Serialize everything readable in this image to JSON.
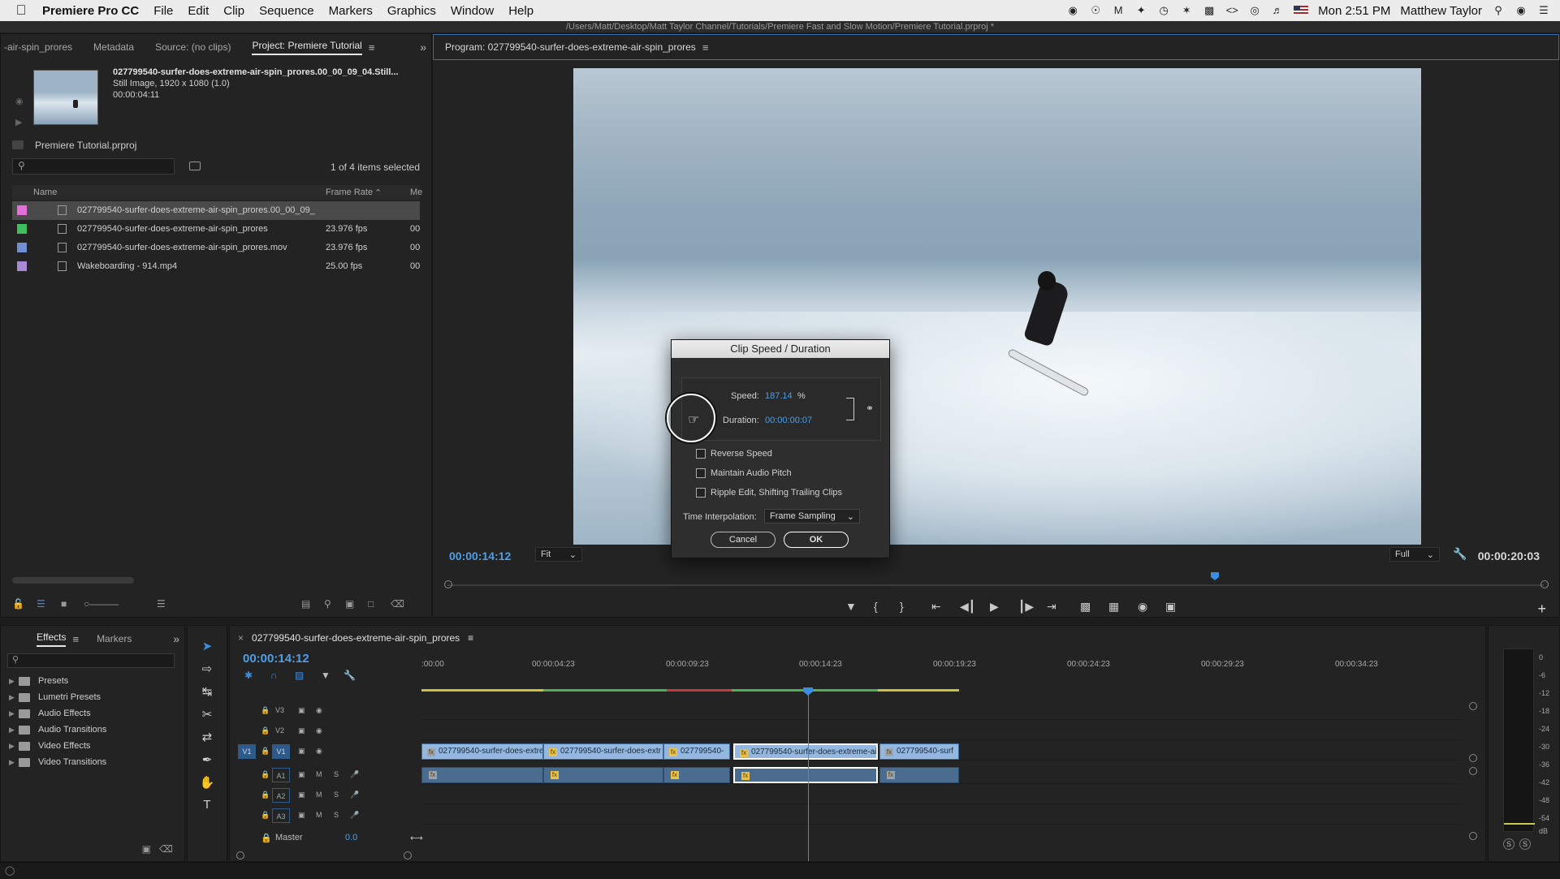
{
  "menubar": {
    "app_name": "Premiere Pro CC",
    "items": [
      "File",
      "Edit",
      "Clip",
      "Sequence",
      "Markers",
      "Graphics",
      "Window",
      "Help"
    ],
    "clock": "Mon 2:51 PM",
    "user": "Matthew Taylor"
  },
  "window": {
    "path": "/Users/Matt/Desktop/Matt Taylor Channel/Tutorials/Premiere Fast and Slow Motion/Premiere Tutorial.prproj *"
  },
  "project_panel": {
    "tabs": [
      "-air-spin_prores",
      "Metadata",
      "Source: (no clips)",
      "Project: Premiere Tutorial"
    ],
    "active_tab": "Project: Premiere Tutorial",
    "clip_info": {
      "name": "027799540-surfer-does-extreme-air-spin_prores.00_00_09_04.Still...",
      "type": "Still Image, 1920 x 1080 (1.0)",
      "duration": "00:00:04:11"
    },
    "project_file": "Premiere Tutorial.prproj",
    "search_placeholder": "",
    "selected_count": "1 of 4 items selected",
    "columns": {
      "name": "Name",
      "frame_rate": "Frame Rate",
      "media": "Me"
    },
    "rows": [
      {
        "swatch": "#e56fd9",
        "name": "027799540-surfer-does-extreme-air-spin_prores.00_00_09_",
        "fps": "",
        "media": "",
        "selected": true
      },
      {
        "swatch": "#3fbf5f",
        "name": "027799540-surfer-does-extreme-air-spin_prores",
        "fps": "23.976 fps",
        "media": "00",
        "selected": false
      },
      {
        "swatch": "#6f8fd0",
        "name": "027799540-surfer-does-extreme-air-spin_prores.mov",
        "fps": "23.976 fps",
        "media": "00",
        "selected": false
      },
      {
        "swatch": "#a68ad8",
        "name": "Wakeboarding - 914.mp4",
        "fps": "25.00 fps",
        "media": "00",
        "selected": false
      }
    ]
  },
  "program_monitor": {
    "title": "Program: 027799540-surfer-does-extreme-air-spin_prores",
    "current_time": "00:00:14:12",
    "fit": "Fit",
    "quality": "Full",
    "duration": "00:00:20:03",
    "playhead_fraction": 0.7
  },
  "dialog": {
    "title": "Clip Speed / Duration",
    "speed_label": "Speed:",
    "speed_value": "187.14",
    "speed_unit": "%",
    "duration_label": "Duration:",
    "duration_value": "00:00:00:07",
    "options": [
      "Reverse Speed",
      "Maintain Audio Pitch",
      "Ripple Edit, Shifting Trailing Clips"
    ],
    "interp_label": "Time Interpolation:",
    "interp_value": "Frame Sampling",
    "cancel": "Cancel",
    "ok": "OK"
  },
  "effects_panel": {
    "tabs": [
      "Effects",
      "Markers"
    ],
    "items": [
      "Presets",
      "Lumetri Presets",
      "Audio Effects",
      "Audio Transitions",
      "Video Effects",
      "Video Transitions"
    ]
  },
  "timeline": {
    "sequence": "027799540-surfer-does-extreme-air-spin_prores",
    "timecode": "00:00:14:12",
    "ruler": [
      ":00:00",
      "00:00:04:23",
      "00:00:09:23",
      "00:00:14:23",
      "00:00:19:23",
      "00:00:24:23",
      "00:00:29:23",
      "00:00:34:23"
    ],
    "video_tracks": [
      {
        "label": "V3",
        "target": ""
      },
      {
        "label": "V2",
        "target": ""
      },
      {
        "label": "V1",
        "target": "V1"
      }
    ],
    "audio_tracks": [
      {
        "label": "A1",
        "m": "M",
        "s": "S"
      },
      {
        "label": "A2",
        "m": "M",
        "s": "S"
      },
      {
        "label": "A3",
        "m": "M",
        "s": "S"
      }
    ],
    "clips": [
      {
        "name": "027799540-surfer-does-extre",
        "fx": false,
        "selected": false
      },
      {
        "name": "027799540-surfer-does-extr",
        "fx": true,
        "selected": false
      },
      {
        "name": "027799540-",
        "fx": true,
        "selected": false
      },
      {
        "name": "027799540-surfer-does-extreme-ai",
        "fx": true,
        "selected": true
      },
      {
        "name": "027799540-surf",
        "fx": false,
        "selected": false
      }
    ],
    "master_label": "Master",
    "master_value": "0.0"
  },
  "audio_meter": {
    "scale": [
      "0",
      "-6",
      "-12",
      "-18",
      "-24",
      "-30",
      "-36",
      "-42",
      "-48",
      "-54",
      "dB"
    ],
    "solo_left": "S",
    "solo_right": "S"
  }
}
